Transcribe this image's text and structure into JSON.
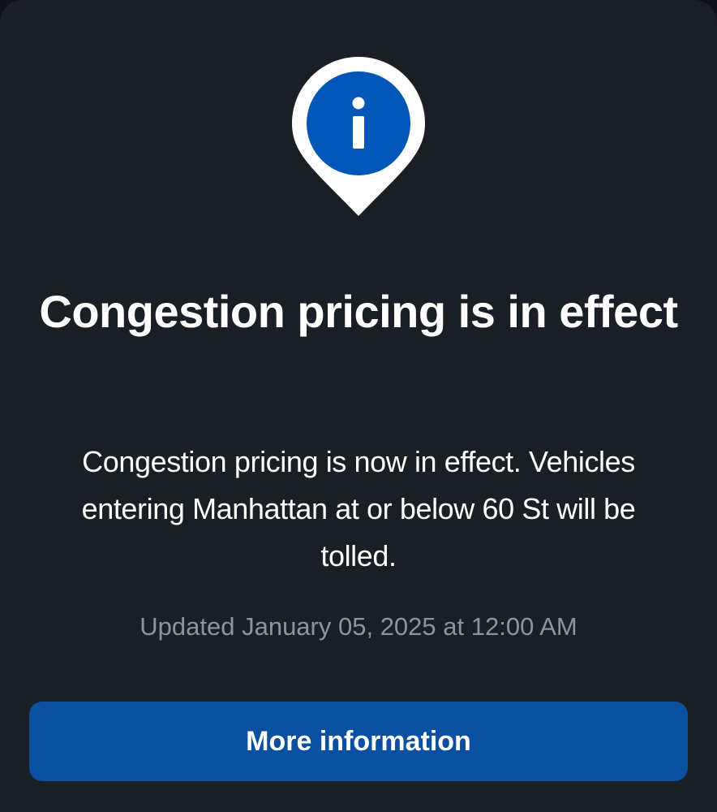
{
  "alert": {
    "icon": "info-location-pin-icon",
    "title": "Congestion pricing is in effect",
    "body": "Congestion pricing is now in effect. Vehicles entering Manhattan at or below 60 St will be tolled.",
    "updated": "Updated January 05, 2025 at 12:00 AM",
    "button_label": "More information"
  },
  "colors": {
    "background": "#1a1f25",
    "accent": "#0a4fa0",
    "pin_blue": "#0057b8",
    "muted_text": "#8e949b"
  }
}
